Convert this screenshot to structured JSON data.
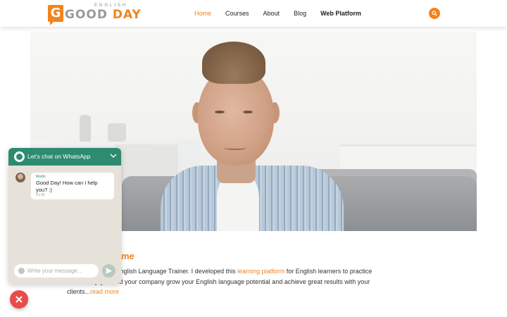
{
  "header": {
    "logo": {
      "top_text": "ENGLISH",
      "main_left": "GOOD",
      "main_right": "DAY",
      "badge_letter": "G"
    },
    "nav": [
      {
        "label": "Home",
        "active": true
      },
      {
        "label": "Courses",
        "active": false
      },
      {
        "label": "About",
        "active": false
      },
      {
        "label": "Blog",
        "active": false
      },
      {
        "label": "Web Platform",
        "active": false
      }
    ],
    "search_icon": "search-icon"
  },
  "hero": {
    "image": "portrait-photo"
  },
  "intro": {
    "heading_visible": "me",
    "text_1": "ssional Business English Language Trainer. I developed this ",
    "link_text": "learning platform",
    "text_2": " for English learners to practice",
    "text_3": "here. I help you and your company grow your English language potential and achieve great results with your",
    "text_4": "clients...",
    "read_more": "read more"
  },
  "whatsapp": {
    "header_title": "Let's chat on WhatsApp",
    "sender": "Martin",
    "message": "Good Day! How can I help you? :)",
    "time": "01:30",
    "input_placeholder": "Write your message...",
    "icons": [
      "whatsapp-icon",
      "chevron-down-icon",
      "emoji-icon",
      "send-icon",
      "close-icon"
    ]
  },
  "colors": {
    "accent": "#f0841e",
    "whatsapp_green": "#2d8b6f",
    "close_red": "#e94b4b"
  }
}
